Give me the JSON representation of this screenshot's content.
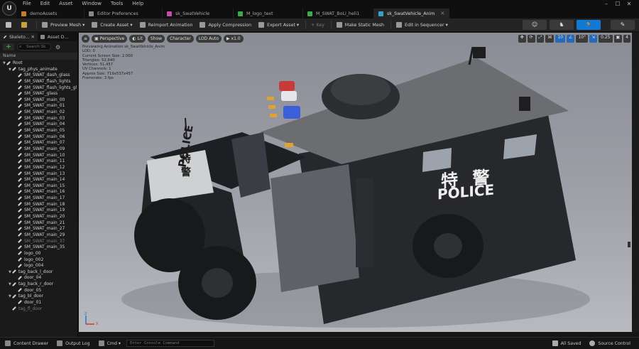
{
  "menu": {
    "logo": "U",
    "items": [
      "File",
      "Edit",
      "Asset",
      "Window",
      "Tools",
      "Help"
    ]
  },
  "window_controls": {
    "minimize": "–",
    "maximize": "☐",
    "close": "✕"
  },
  "tabs": [
    {
      "label": "demoAssets",
      "color": "#c97a2b"
    },
    {
      "label": "Editor Preferences",
      "color": "#888888"
    },
    {
      "label": "sk_SwatVehicle",
      "color": "#c24fa2"
    },
    {
      "label": "M_logo_text",
      "color": "#3fa84a"
    },
    {
      "label": "M_SWAT_BoLi_heli1",
      "color": "#3fa84a"
    },
    {
      "label": "sk_SwatVehicle_Anim",
      "color": "#3a9ec7"
    }
  ],
  "toolbar": {
    "preview_mesh": "Preview Mesh",
    "create_asset": "Create Asset",
    "reimport": "Reimport Animation",
    "apply_compression": "Apply Compression",
    "export_asset": "Export Asset",
    "key": "Key",
    "make_static_mesh": "Make Static Mesh",
    "edit_sequencer": "Edit in Sequencer",
    "modes": [
      "☺",
      "♞",
      "🏃",
      "✎"
    ]
  },
  "left_panel": {
    "tabs": [
      "Skeleto...",
      "Asset D..."
    ],
    "add_label": "+",
    "search_placeholder": "Search Sk",
    "filter_icon": "⚙",
    "column_name": "Name",
    "tree": [
      {
        "label": "Root",
        "indent": 0,
        "arrow": "▼",
        "dim": false
      },
      {
        "label": "tag_phys_animate",
        "indent": 1,
        "arrow": "▼",
        "dim": false
      },
      {
        "label": "SM_SWAT_dash_glass",
        "indent": 2,
        "arrow": "",
        "dim": false
      },
      {
        "label": "SM_SWAT_flash_lights",
        "indent": 2,
        "arrow": "",
        "dim": false
      },
      {
        "label": "SM_SWAT_flash_lights_gl",
        "indent": 2,
        "arrow": "",
        "dim": false
      },
      {
        "label": "SM_SWAT_glass",
        "indent": 2,
        "arrow": "",
        "dim": false
      },
      {
        "label": "SM_SWAT_main_00",
        "indent": 2,
        "arrow": "",
        "dim": false
      },
      {
        "label": "SM_SWAT_main_01",
        "indent": 2,
        "arrow": "",
        "dim": false
      },
      {
        "label": "SM_SWAT_main_02",
        "indent": 2,
        "arrow": "",
        "dim": false
      },
      {
        "label": "SM_SWAT_main_03",
        "indent": 2,
        "arrow": "",
        "dim": false
      },
      {
        "label": "SM_SWAT_main_04",
        "indent": 2,
        "arrow": "",
        "dim": false
      },
      {
        "label": "SM_SWAT_main_05",
        "indent": 2,
        "arrow": "",
        "dim": false
      },
      {
        "label": "SM_SWAT_main_06",
        "indent": 2,
        "arrow": "",
        "dim": false
      },
      {
        "label": "SM_SWAT_main_07",
        "indent": 2,
        "arrow": "",
        "dim": false
      },
      {
        "label": "SM_SWAT_main_09",
        "indent": 2,
        "arrow": "",
        "dim": false
      },
      {
        "label": "SM_SWAT_main_10",
        "indent": 2,
        "arrow": "",
        "dim": false
      },
      {
        "label": "SM_SWAT_main_11",
        "indent": 2,
        "arrow": "",
        "dim": false
      },
      {
        "label": "SM_SWAT_main_12",
        "indent": 2,
        "arrow": "",
        "dim": false
      },
      {
        "label": "SM_SWAT_main_13",
        "indent": 2,
        "arrow": "",
        "dim": false
      },
      {
        "label": "SM_SWAT_main_14",
        "indent": 2,
        "arrow": "",
        "dim": false
      },
      {
        "label": "SM_SWAT_main_15",
        "indent": 2,
        "arrow": "",
        "dim": false
      },
      {
        "label": "SM_SWAT_main_16",
        "indent": 2,
        "arrow": "",
        "dim": false
      },
      {
        "label": "SM_SWAT_main_17",
        "indent": 2,
        "arrow": "",
        "dim": false
      },
      {
        "label": "SM_SWAT_main_18",
        "indent": 2,
        "arrow": "",
        "dim": false
      },
      {
        "label": "SM_SWAT_main_19",
        "indent": 2,
        "arrow": "",
        "dim": false
      },
      {
        "label": "SM_SWAT_main_20",
        "indent": 2,
        "arrow": "",
        "dim": false
      },
      {
        "label": "SM_SWAT_main_21",
        "indent": 2,
        "arrow": "",
        "dim": false
      },
      {
        "label": "SM_SWAT_main_27",
        "indent": 2,
        "arrow": "",
        "dim": false
      },
      {
        "label": "SM_SWAT_main_29",
        "indent": 2,
        "arrow": "",
        "dim": false
      },
      {
        "label": "SM_SWAT_main_37",
        "indent": 2,
        "arrow": "",
        "dim": true
      },
      {
        "label": "SM_SWAT_main_35",
        "indent": 2,
        "arrow": "",
        "dim": false
      },
      {
        "label": "logo_00",
        "indent": 2,
        "arrow": "",
        "dim": false
      },
      {
        "label": "logo_002",
        "indent": 2,
        "arrow": "",
        "dim": false
      },
      {
        "label": "logo_004",
        "indent": 2,
        "arrow": "",
        "dim": false
      },
      {
        "label": "tag_back_l_door",
        "indent": 1,
        "arrow": "▼",
        "dim": false
      },
      {
        "label": "door_04",
        "indent": 2,
        "arrow": "",
        "dim": false
      },
      {
        "label": "tag_back_r_door",
        "indent": 1,
        "arrow": "▼",
        "dim": false
      },
      {
        "label": "door_05",
        "indent": 2,
        "arrow": "",
        "dim": false
      },
      {
        "label": "tag_bl_door",
        "indent": 1,
        "arrow": "▼",
        "dim": false
      },
      {
        "label": "door_01",
        "indent": 2,
        "arrow": "",
        "dim": false
      },
      {
        "label": "tag_fl_door",
        "indent": 1,
        "arrow": "",
        "dim": true
      }
    ]
  },
  "viewport": {
    "menu_icon": "≡",
    "perspective": "Perspective",
    "lit": "Lit",
    "show": "Show",
    "character": "Character",
    "lod": "LOD Auto",
    "speed": "x1.0",
    "right_tools": [
      "✥",
      "⟳",
      "⤢",
      "⌘",
      "10",
      "∠",
      "10°",
      "⇲",
      "0.25",
      "▣",
      "4"
    ],
    "stats": [
      "Previewing Animation sk_SwatVehicle_Anim",
      "LOD: 0",
      "Current Screen Size: 2.000",
      "Triangles: 52,640",
      "Vertices: 51,457",
      "UV Channels: 1",
      "Approx Size: 719x537x457",
      "Framerate: 3 fps"
    ],
    "decal_text_side": "特 警",
    "decal_police_side": "POLICE",
    "decal_text_front": "特 警",
    "decal_police_front": "POLICE",
    "axis_z": "Z",
    "axis_x": "X"
  },
  "bottom": {
    "content_drawer": "Content Drawer",
    "output_log": "Output Log",
    "cmd": "Cmd",
    "console_placeholder": "Enter Console Command",
    "all_saved": "All Saved",
    "source_control": "Source Control"
  }
}
